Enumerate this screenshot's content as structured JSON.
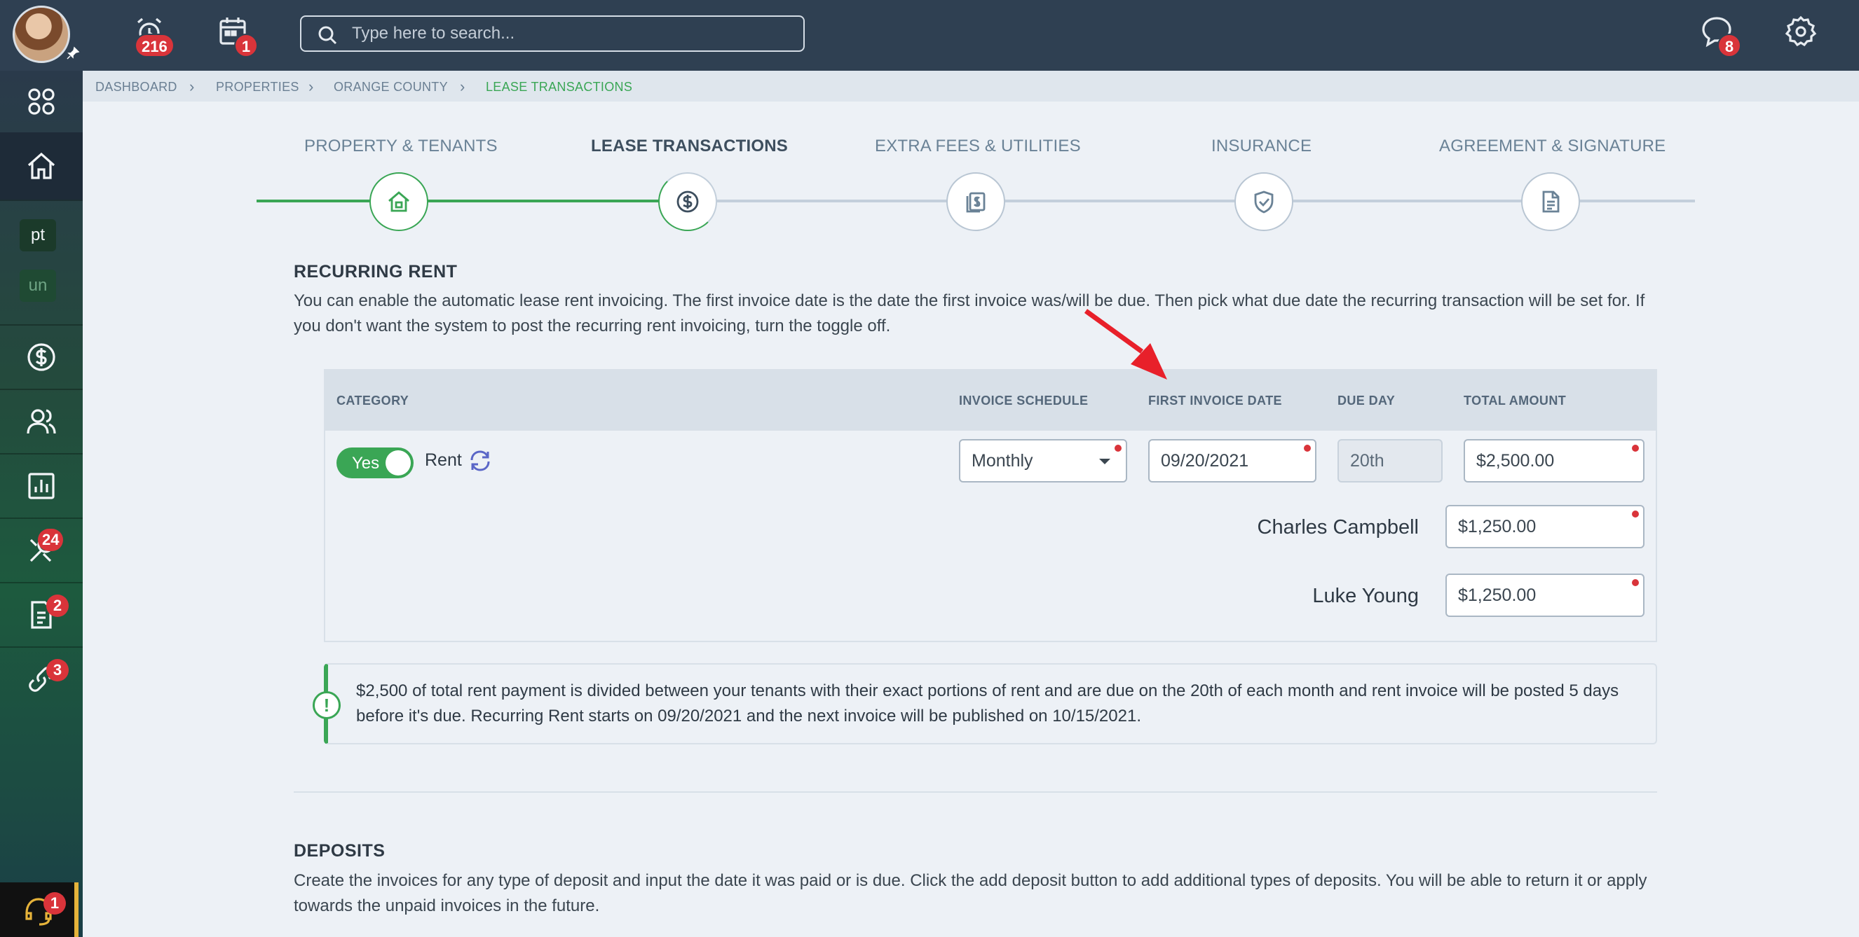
{
  "topbar": {
    "alerts_badge": "216",
    "calendar_badge": "1",
    "messages_badge": "8",
    "search_placeholder": "Type here to search..."
  },
  "sidebar": {
    "chip_pt": "pt",
    "chip_un": "un",
    "tools_badge": "24",
    "docs_badge": "2",
    "links_badge": "3",
    "help_badge": "1"
  },
  "breadcrumb": [
    "DASHBOARD",
    "PROPERTIES",
    "ORANGE COUNTY",
    "LEASE TRANSACTIONS"
  ],
  "steps": [
    "PROPERTY & TENANTS",
    "LEASE TRANSACTIONS",
    "EXTRA FEES & UTILITIES",
    "INSURANCE",
    "AGREEMENT & SIGNATURE"
  ],
  "recurring": {
    "title": "RECURRING RENT",
    "description": "You can enable the automatic lease rent invoicing. The first invoice date is the date the first invoice was/will be due. Then pick what due date the recurring transaction will be set for. If you don't want the system to post the recurring rent invoicing, turn the toggle off.",
    "headers": {
      "category": "CATEGORY",
      "schedule": "INVOICE SCHEDULE",
      "first_date": "FIRST INVOICE DATE",
      "due_day": "DUE DAY",
      "total": "TOTAL AMOUNT"
    },
    "toggle_label": "Yes",
    "category": "Rent",
    "schedule": "Monthly",
    "first_date": "09/20/2021",
    "due_day": "20th",
    "total": "$2,500.00",
    "tenants": [
      {
        "name": "Charles Campbell",
        "amount": "$1,250.00"
      },
      {
        "name": "Luke Young",
        "amount": "$1,250.00"
      }
    ],
    "info": "$2,500 of total rent payment is divided between your tenants with their exact portions of rent and are due on the 20th of each month and rent invoice will be posted 5 days before it's due. Recurring Rent starts on 09/20/2021 and the next invoice will be published on 10/15/2021."
  },
  "deposits": {
    "title": "DEPOSITS",
    "description": "Create the invoices for any type of deposit and input the date it was paid or is due. Click the add deposit button to add additional types of deposits. You will be able to return it or apply towards the unpaid invoices in the future."
  },
  "colors": {
    "topbar": "#2f4052",
    "accent_green": "#3aa655",
    "badge_red": "#d9343a",
    "arrow_red": "#e8202a"
  }
}
